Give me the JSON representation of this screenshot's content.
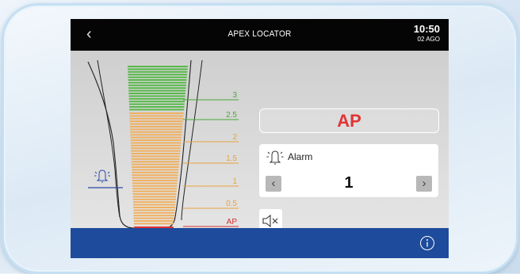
{
  "titlebar": {
    "back_icon": "chevron-left-icon",
    "title": "APEX LOCATOR",
    "time": "10:50",
    "date": "02 AGO"
  },
  "scale": {
    "labels": [
      {
        "text": "3",
        "color": "#4aa838"
      },
      {
        "text": "2.5",
        "color": "#4aa838"
      },
      {
        "text": "2",
        "color": "#e9a23c"
      },
      {
        "text": "1.5",
        "color": "#e9a23c"
      },
      {
        "text": "1",
        "color": "#e9a23c"
      },
      {
        "text": "0.5",
        "color": "#e9a23c"
      },
      {
        "text": "AP",
        "color": "#d62e2e"
      }
    ],
    "alarm_marker_icon": "bell-icon",
    "alarm_level": 1,
    "colors": {
      "green": "#56b848",
      "orange": "#f0b060",
      "red": "#e03030",
      "marker": "#2a4aa8"
    }
  },
  "status": {
    "value": "AP",
    "color": "#e23434"
  },
  "alarm": {
    "icon": "bell-icon",
    "label": "Alarm",
    "value": "1",
    "decrease_icon": "chevron-left-icon",
    "increase_icon": "chevron-right-icon"
  },
  "mute_icon": "speaker-mute-icon",
  "bottombar": {
    "info_icon": "info-icon",
    "color": "#1e4b9b"
  }
}
